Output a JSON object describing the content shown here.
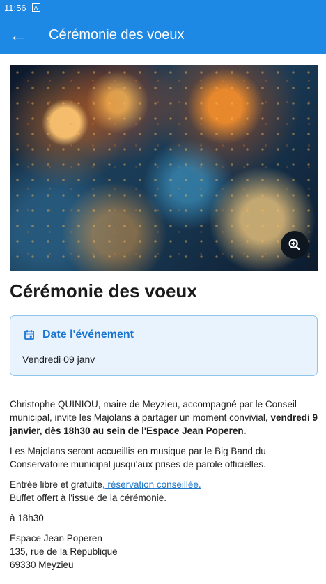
{
  "status_bar": {
    "time": "11:56",
    "indicator": "A"
  },
  "app_bar": {
    "back_icon": "arrow-left-icon",
    "title": "Cérémonie des voeux",
    "color": "#1e88e5"
  },
  "hero": {
    "zoom_icon": "zoom-in-icon"
  },
  "event": {
    "title": "Cérémonie des voeux",
    "date_label": "Date l'événement",
    "date_value": "Vendredi 09 janv",
    "intro_start": "Christophe QUINIOU, maire de Meyzieu, accompagné par le Conseil municipal, invite les Majolans à partager un moment convivial,",
    "intro_bold": "vendredi 9 janvier, dès 18h30 au sein de l'Espace Jean Poperen.",
    "music_text": "Les Majolans seront accueillis en musique par le Big Band du Conservatoire municipal jusqu'aux prises de parole officielles.",
    "entry_prefix": "Entrée libre et gratuite",
    "entry_link": ", réservation conseillée.",
    "buffet_text": "Buffet offert à l'issue de la cérémonie.",
    "time_text": "à 18h30",
    "address_line_1": "Espace Jean Poperen",
    "address_line_2": "135, rue de la République",
    "address_line_3": "69330 Meyzieu"
  }
}
